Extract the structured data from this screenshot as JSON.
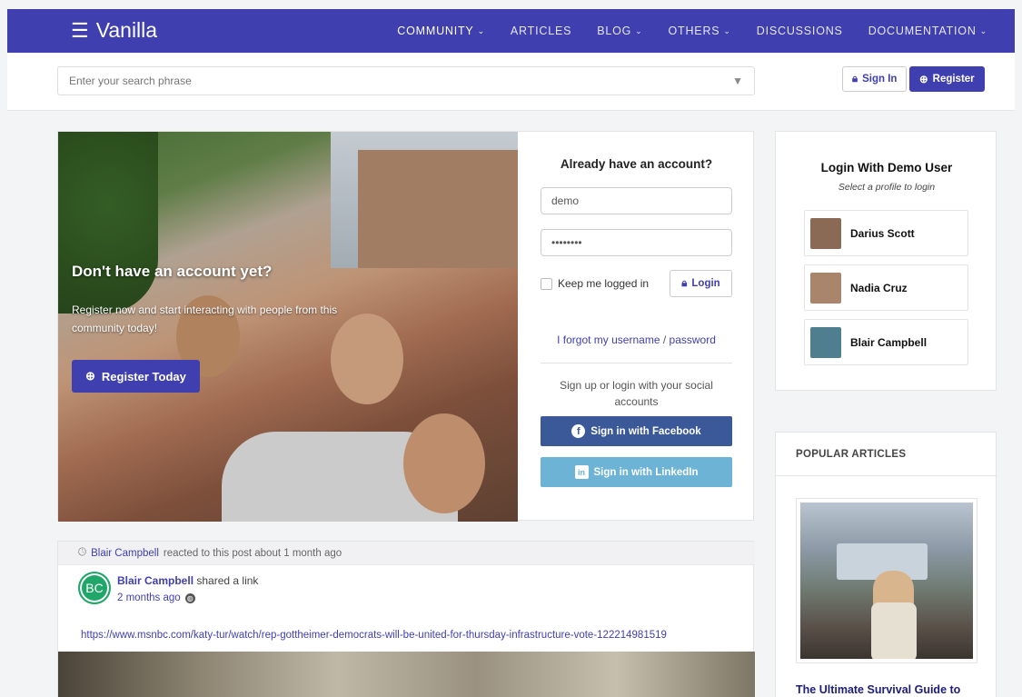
{
  "header": {
    "brand": "Vanilla",
    "nav": [
      {
        "label": "COMMUNITY",
        "dropdown": true
      },
      {
        "label": "ARTICLES",
        "dropdown": false
      },
      {
        "label": "BLOG",
        "dropdown": true
      },
      {
        "label": "OTHERS",
        "dropdown": true
      },
      {
        "label": "DISCUSSIONS",
        "dropdown": false
      },
      {
        "label": "DOCUMENTATION",
        "dropdown": true
      }
    ]
  },
  "search": {
    "placeholder": "Enter your search phrase"
  },
  "auth": {
    "signin": "Sign In",
    "register": "Register"
  },
  "hero": {
    "title": "Don't have an account yet?",
    "text": "Register now and start interacting with people from this community today!",
    "cta": "Register Today"
  },
  "login": {
    "title": "Already have an account?",
    "username": "demo",
    "password": "••••••••",
    "keep": "Keep me logged in",
    "button": "Login",
    "forgot_username": "I forgot my username",
    "forgot_sep": "/",
    "forgot_password": "password",
    "social_text": "Sign up or login with your social accounts",
    "facebook": "Sign in with Facebook",
    "linkedin": "Sign in with LinkedIn"
  },
  "demo": {
    "title": "Login With Demo User",
    "subtitle": "Select a profile to login",
    "users": [
      {
        "name": "Darius Scott",
        "color": "#8a6a55"
      },
      {
        "name": "Nadia Cruz",
        "color": "#a9856c"
      },
      {
        "name": "Blair Campbell",
        "color": "#4f7f8f"
      }
    ]
  },
  "popular": {
    "heading": "POPULAR ARTICLES",
    "article_title": "The Ultimate Survival Guide to"
  },
  "feed": {
    "reacted_user": "Blair Campbell",
    "reacted_text": "reacted to this post about 1 month ago",
    "avatar_initials": "BC",
    "author": "Blair Campbell",
    "action": "shared a link",
    "time": "2 months ago",
    "url": "https://www.msnbc.com/katy-tur/watch/rep-gottheimer-democrats-will-be-united-for-thursday-infrastructure-vote-122214981519"
  }
}
